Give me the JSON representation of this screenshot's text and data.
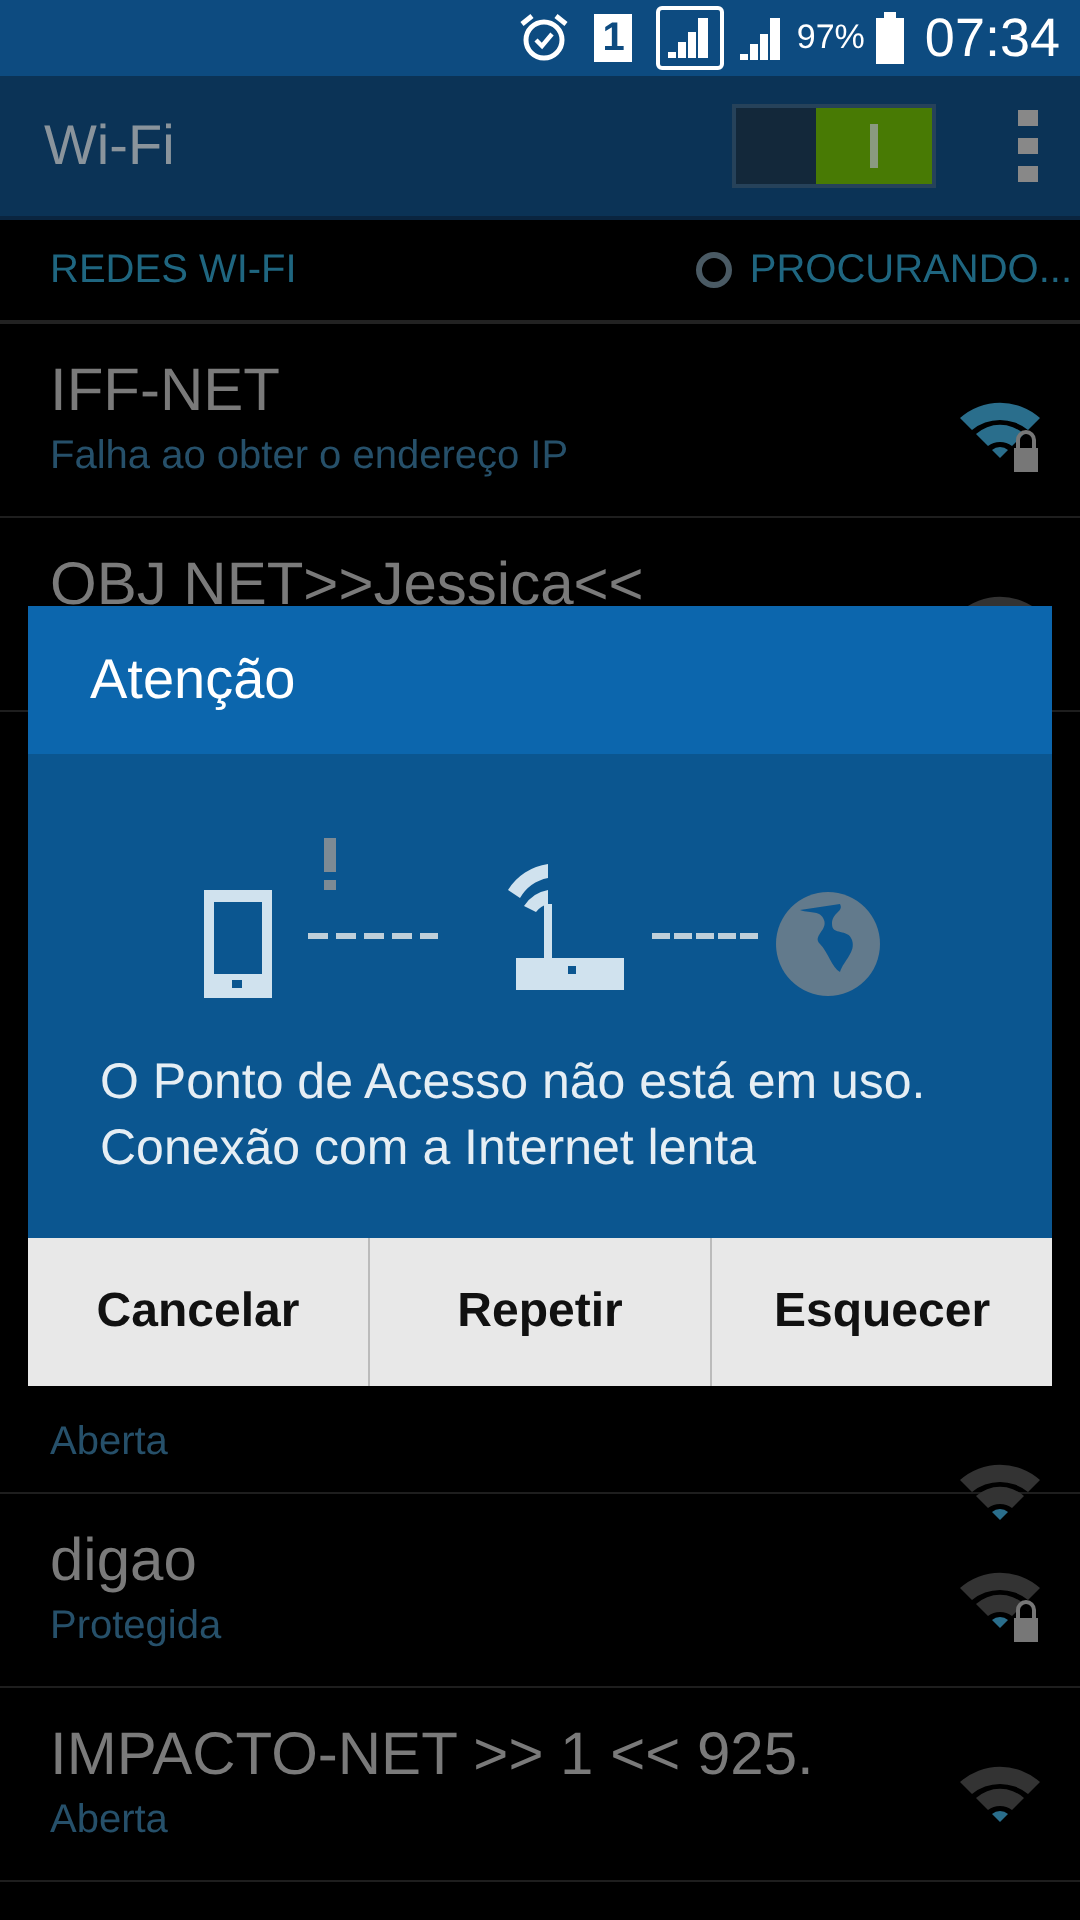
{
  "status_bar": {
    "sim_slot": "1",
    "battery": "97%",
    "time": "07:34"
  },
  "action_bar": {
    "title": "Wi-Fi",
    "wifi_on": true
  },
  "section": {
    "label": "REDES WI-FI",
    "status": "PROCURANDO..."
  },
  "networks": [
    {
      "name": "IFF-NET",
      "status": "Falha ao obter o endereço IP",
      "locked": true,
      "active": true
    },
    {
      "name": "OBJ NET>>Jessica<<",
      "active": false
    },
    {
      "status": "Aberta",
      "locked": false,
      "active": false
    },
    {
      "name": "digao",
      "status": "Protegida",
      "locked": true,
      "active": false
    },
    {
      "name": "IMPACTO-NET >> 1 <<  925.",
      "status": "Aberta",
      "locked": false,
      "active": false
    }
  ],
  "dialog": {
    "title": "Atenção",
    "message": "O Ponto de Acesso não está em uso. Conexão com a Internet lenta",
    "buttons": [
      "Cancelar",
      "Repetir",
      "Esquecer"
    ]
  }
}
